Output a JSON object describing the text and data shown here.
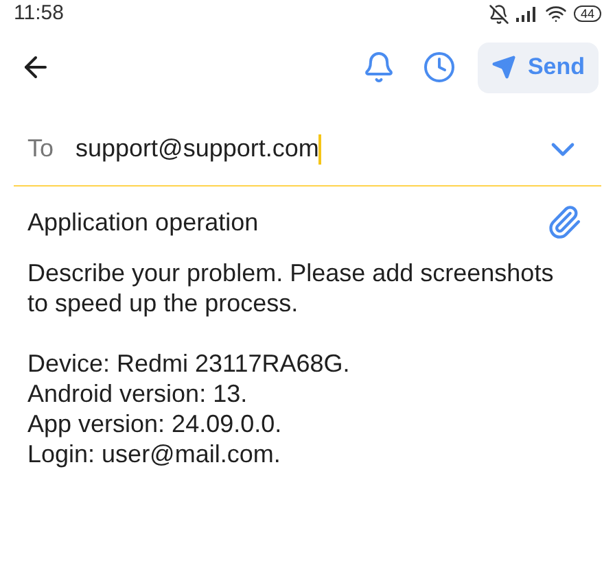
{
  "status_bar": {
    "time": "11:58",
    "battery": "44"
  },
  "toolbar": {
    "send_label": "Send"
  },
  "to_field": {
    "label": "To",
    "value": "support@support.com",
    "focused": true
  },
  "subject": {
    "value": "Application operation"
  },
  "body": [
    [
      "Describe your problem. Please add screenshots",
      "to speed up the process."
    ],
    [
      "Device: Redmi 23117RA68G.",
      "Android version: 13.",
      "App version: 24.09.0.0.",
      "Login: user@mail.com."
    ]
  ]
}
